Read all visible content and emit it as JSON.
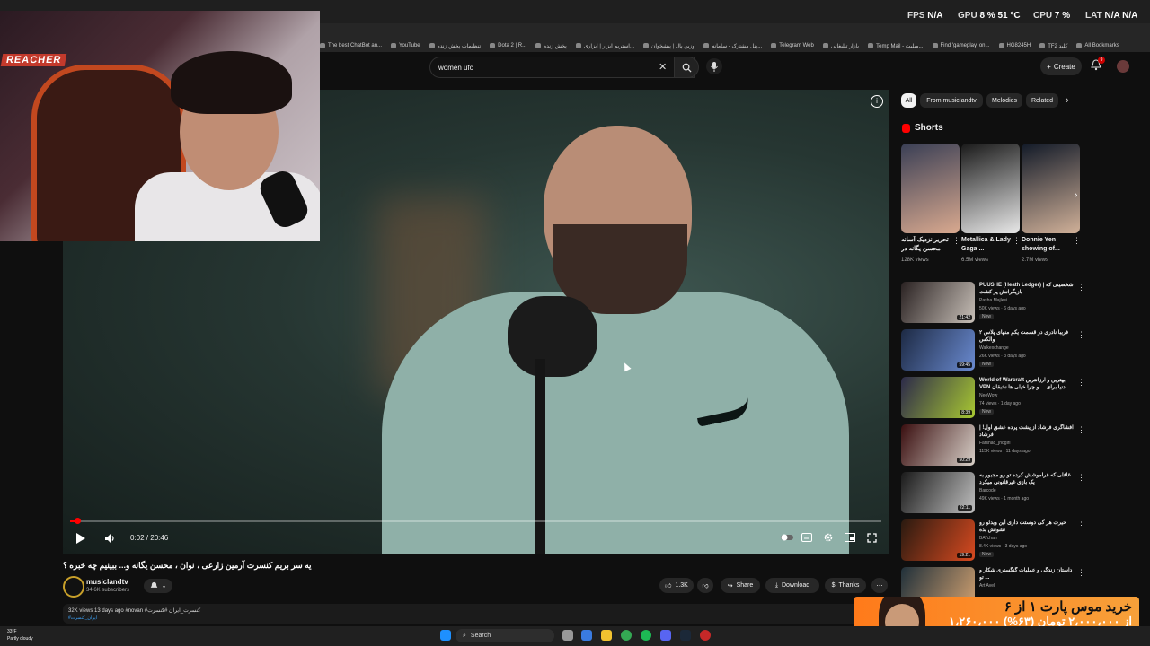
{
  "browser": {
    "stats": {
      "fps_label": "FPS",
      "fps": "N/A",
      "gpu_label": "GPU",
      "gpu": "8 % 51 °C",
      "cpu_label": "CPU",
      "cpu": "7 %",
      "lat_label": "LAT",
      "lat": "N/A N/A"
    },
    "bookmarks": [
      "The best ChatBot an...",
      "YouTube",
      "تنظیمات پخش زنده",
      "Dota 2 | R...",
      "پخش زنده",
      "استریم ابزار | ابزاری...",
      "وزین پال | پیشخوان",
      "پنل مشترک - سامانه...",
      "Telegram Web",
      "بازار تبلیغاتی",
      "Temp Mail - میلیت...",
      "Find 'gameplay' on...",
      "HG8245H",
      "TF2 کلید",
      "All Bookmarks"
    ]
  },
  "webcam": {
    "name_tag": "REACHER"
  },
  "header": {
    "search": {
      "value": "women ufc"
    },
    "create_label": "Create",
    "notification_count": "9"
  },
  "player": {
    "time": "0:02 / 20:46",
    "progress": 0.0016
  },
  "video": {
    "title": "یه سر بریم کنسرت آرمین زارعی ، نوان ، محسن یگانه و... ببینیم چه خبره ؟",
    "channel": "musicIandtv",
    "subscribers": "34.6K subscribers",
    "likes": "1.3K",
    "share_label": "Share",
    "download_label": "Download",
    "thanks_label": "Thanks",
    "meta": "32K views  13 days ago  #novan #کنسرت_ایران #کنسرت",
    "tag": "#ایران_کنسرت"
  },
  "chips": [
    {
      "label": "All",
      "active": true
    },
    {
      "label": "From musicIandtv",
      "active": false
    },
    {
      "label": "Melodies",
      "active": false
    },
    {
      "label": "Related",
      "active": false
    }
  ],
  "shorts": {
    "title": "Shorts",
    "items": [
      {
        "title": "تحریر نزدیک آسانه محسن یگانه در",
        "views": "128K views",
        "colors": [
          "#3a3f55",
          "#d9a98f"
        ]
      },
      {
        "title": "Metallica & Lady Gaga ...",
        "views": "6.5M views",
        "colors": [
          "#1a1a1a",
          "#e8e8e8"
        ]
      },
      {
        "title": "Donnie Yen showing of...",
        "views": "2.7M views",
        "colors": [
          "#121a28",
          "#d0b098"
        ]
      }
    ]
  },
  "recommended": [
    {
      "title": "PUUSHE (Heath Ledger) | شخصیتی که بازیگرانش پر کشت",
      "channel": "Pasha Majlesi",
      "meta": "50K views · 6 days ago",
      "badge": "New",
      "duration": "21:42",
      "colors": [
        "#2a2222",
        "#c8c0b8"
      ]
    },
    {
      "title": "فریبا نادری در قسمت یکم منهای پلاس ۲ والکس",
      "channel": "Walkexchange",
      "meta": "26K views · 3 days ago",
      "badge": "New",
      "duration": "59:45",
      "colors": [
        "#1d2a44",
        "#6a8ad0"
      ]
    },
    {
      "title": "World of Warcraft بهترین و ارزانترین VPN دنیا برای ... و چرا خیلی ها نخبقان",
      "channel": "NeoWow",
      "meta": "74 views · 1 day ago",
      "badge": "New",
      "duration": "8:39",
      "colors": [
        "#2c2a4a",
        "#a8c832"
      ]
    },
    {
      "title": "افشاگری فرشاد از پشت پرده عشق اول! | فرشاد",
      "channel": "Farshad_jhogiri",
      "meta": "115K views · 11 days ago",
      "badge": "",
      "duration": "50:29",
      "colors": [
        "#3a0f10",
        "#d8d0c8"
      ]
    },
    {
      "title": "غافلی که فراموشش کرده تو رو مجبور به یک بازی غیرقانونی میکرد",
      "channel": "Barcode",
      "meta": "49K views · 1 month ago",
      "badge": "",
      "duration": "22:11",
      "colors": [
        "#1a1a1a",
        "#bfbfbf"
      ]
    },
    {
      "title": "حیرت هر کی دوستت داری این ویدئو رو نشونش بده",
      "channel": "BATchan",
      "meta": "8.4K views · 3 days ago",
      "badge": "New",
      "duration": "19:21",
      "colors": [
        "#2a1a10",
        "#d84a20"
      ]
    },
    {
      "title": "داستان زندگی و عملیات گنگستری شکار و ... تو",
      "channel": "Art Avel",
      "meta": "",
      "badge": "",
      "duration": "",
      "colors": [
        "#20303a",
        "#d0a070"
      ]
    }
  ],
  "promo": {
    "line1": "خرید موس پارت ۱ از ۶",
    "line2": "۱،۲۶۰،۰۰۰ از ۲،۰۰۰،۰۰۰ تومان (۶۳%)",
    "line3": ""
  },
  "taskbar": {
    "weather_temp": "33°F",
    "weather_desc": "Partly cloudy",
    "search_label": "Search"
  }
}
